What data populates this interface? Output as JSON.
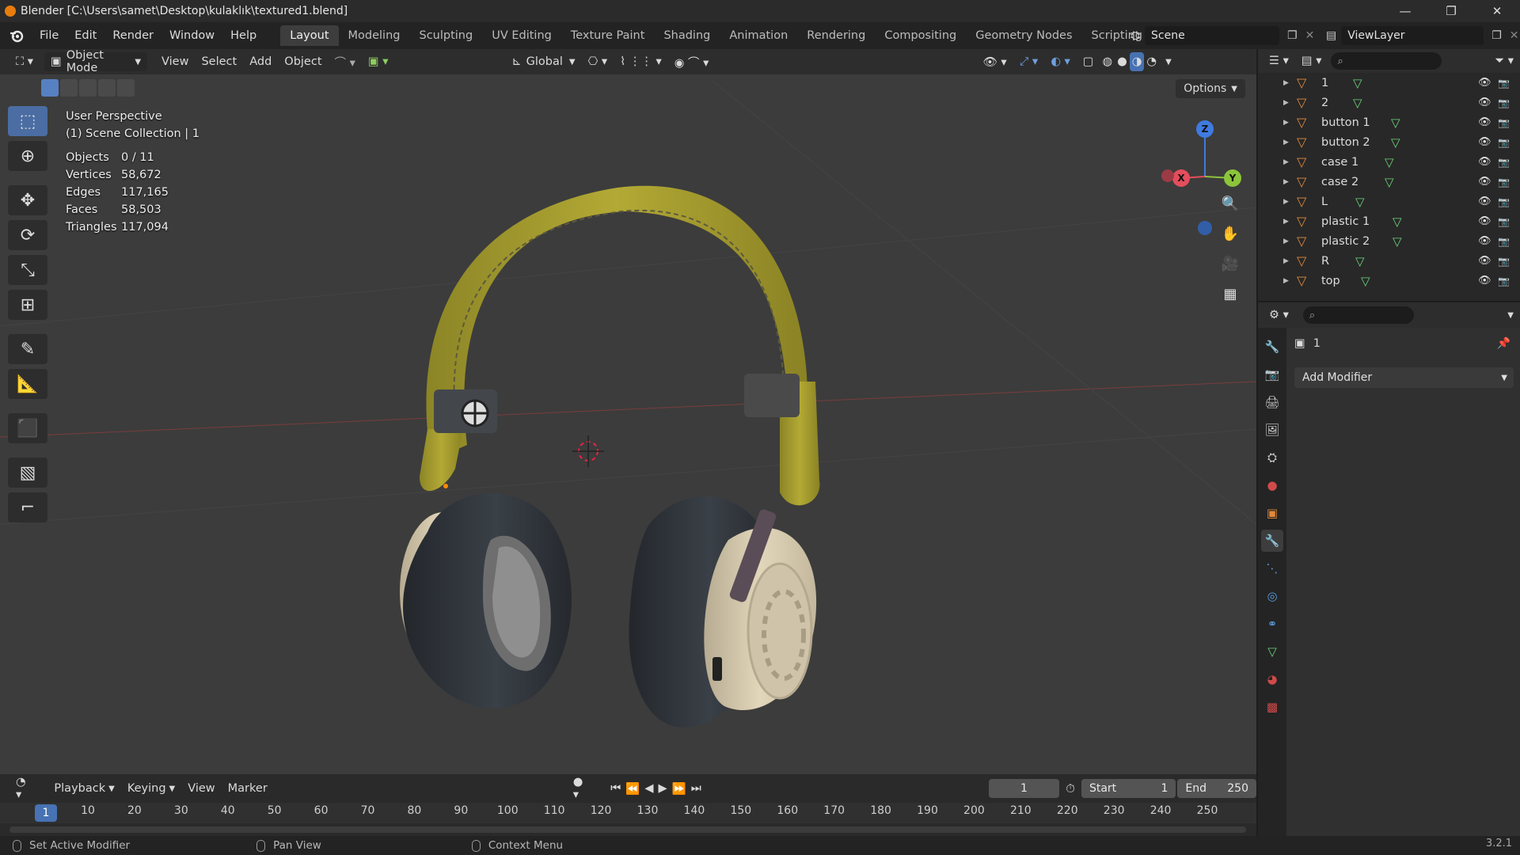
{
  "titlebar": {
    "title": "Blender [C:\\Users\\samet\\Desktop\\kulaklık\\textured1.blend]",
    "minimize_icon": "—",
    "restore_icon": "❐",
    "close_icon": "✕"
  },
  "menubar": {
    "menus": [
      "File",
      "Edit",
      "Render",
      "Window",
      "Help"
    ],
    "workspace_tabs": [
      "Layout",
      "Modeling",
      "Sculpting",
      "UV Editing",
      "Texture Paint",
      "Shading",
      "Animation",
      "Rendering",
      "Compositing",
      "Geometry Nodes",
      "Scripting"
    ],
    "active_workspace": "Layout",
    "add_workspace": "+",
    "scene": "Scene",
    "view_layer": "ViewLayer"
  },
  "viewport": {
    "mode": "Object Mode",
    "menus": [
      "View",
      "Select",
      "Add",
      "Object"
    ],
    "transform_orientation": "Global",
    "options_label": "Options",
    "perspective_label": "User Perspective",
    "collection_label": "(1) Scene Collection | 1",
    "stats": [
      {
        "label": "Objects",
        "value": "0 / 11"
      },
      {
        "label": "Vertices",
        "value": "58,672"
      },
      {
        "label": "Edges",
        "value": "117,165"
      },
      {
        "label": "Faces",
        "value": "58,503"
      },
      {
        "label": "Triangles",
        "value": "117,094"
      }
    ],
    "gizmo": {
      "x": "X",
      "y": "Y",
      "z": "Z"
    },
    "colors": {
      "background": "#3c3c3c",
      "x_axis": "#e54d5c",
      "y_axis": "#8cc43b",
      "z_axis": "#3f7be0",
      "band": "#b0a531",
      "earcup": "#2e3237",
      "housing": "#d9ccb0"
    }
  },
  "timeline": {
    "menus": [
      "Playback",
      "Keying",
      "View",
      "Marker"
    ],
    "current_frame": "1",
    "start_label": "Start",
    "start": "1",
    "end_label": "End",
    "end": "250",
    "ticks": [
      "1",
      "10",
      "20",
      "30",
      "40",
      "50",
      "60",
      "70",
      "80",
      "90",
      "100",
      "110",
      "120",
      "130",
      "140",
      "150",
      "160",
      "170",
      "180",
      "190",
      "200",
      "210",
      "220",
      "230",
      "240",
      "250"
    ]
  },
  "statusbar": {
    "items": [
      "Set Active Modifier",
      "Pan View",
      "Context Menu"
    ],
    "version": "3.2.1"
  },
  "outliner": {
    "search_placeholder": "",
    "objects": [
      "1",
      "2",
      "button 1",
      "button 2",
      "case 1",
      "case 2",
      "L",
      "plastic 1",
      "plastic 2",
      "R",
      "top"
    ]
  },
  "properties": {
    "object_name": "1",
    "add_modifier": "Add Modifier",
    "active_tab": "modifier"
  }
}
